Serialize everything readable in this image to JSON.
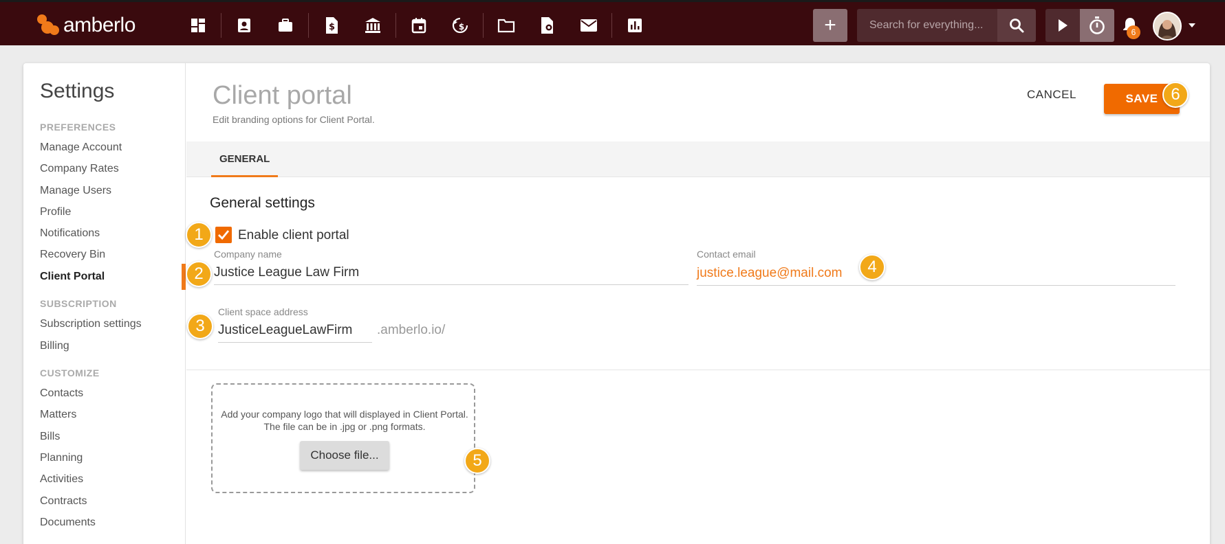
{
  "app": {
    "logo_text": "amberlo"
  },
  "topbar": {
    "nav_icons": [
      "dashboard-icon",
      "contacts-icon",
      "matters-icon",
      "bills-icon",
      "bank-icon",
      "calendar-icon",
      "activities-icon",
      "documents-icon",
      "contracts-icon",
      "mail-icon",
      "reports-icon"
    ],
    "add_label": "+",
    "search_placeholder": "Search for everything...",
    "notification_count": "6"
  },
  "sidebar": {
    "title": "Settings",
    "sections": [
      {
        "label": "PREFERENCES",
        "items": [
          "Manage Account",
          "Company Rates",
          "Manage Users",
          "Profile",
          "Notifications",
          "Recovery Bin",
          "Client Portal"
        ]
      },
      {
        "label": "SUBSCRIPTION",
        "items": [
          "Subscription settings",
          "Billing"
        ]
      },
      {
        "label": "CUSTOMIZE",
        "items": [
          "Contacts",
          "Matters",
          "Bills",
          "Planning",
          "Activities",
          "Contracts",
          "Documents"
        ]
      }
    ],
    "active_item": "Client Portal"
  },
  "page": {
    "title": "Client portal",
    "subtitle": "Edit branding options for Client Portal.",
    "cancel_label": "CANCEL",
    "save_label": "SAVE",
    "tabs": [
      {
        "label": "GENERAL",
        "active": true
      }
    ],
    "section_title": "General settings",
    "enable_label": "Enable client portal",
    "enable_checked": true,
    "company_name_label": "Company name",
    "company_name_value": "Justice League Law Firm",
    "contact_email_label": "Contact email",
    "contact_email_value": "justice.league@mail.com",
    "client_space_label": "Client space address",
    "client_space_value": "JusticeLeagueLawFirm",
    "client_space_suffix": ".amberlo.io/",
    "logo_hint": "Add your company logo that will displayed in Client Portal. The file can be in .jpg or .png formats.",
    "choose_file_label": "Choose file..."
  },
  "annotations": [
    "1",
    "2",
    "3",
    "4",
    "5",
    "6"
  ],
  "colors": {
    "topbar": "#3a0a0e",
    "accent": "#f06a00",
    "annotation": "#f2a818"
  }
}
